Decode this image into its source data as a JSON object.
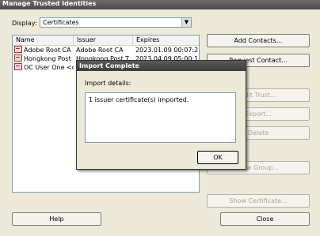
{
  "window": {
    "title": "Manage Trusted Identities"
  },
  "display": {
    "label": "Display:",
    "value": "Certificates"
  },
  "list": {
    "columns": [
      "Name",
      "Issuer",
      "Expires"
    ],
    "rows": [
      {
        "name": "Adobe Root CA",
        "issuer": "Adobe Root CA",
        "expires": "2023.01.09 00:07:2..."
      },
      {
        "name": "Hongkong Post ...",
        "issuer": "Hongkong Post T...",
        "expires": "2023.04.09 05:00:1..."
      },
      {
        "name": "OC User One <o...",
        "issuer": "",
        "expires": ""
      }
    ]
  },
  "buttons": {
    "add_contacts": "Add Contacts...",
    "request_contact": "Request Contact...",
    "edit_trust": "Edit Trust...",
    "export": "Export...",
    "delete": "Delete",
    "new_group": "New Group...",
    "show_certificate": "Show Certificate...",
    "help": "Help",
    "close": "Close"
  },
  "dialog": {
    "title": "Import Complete",
    "details_label": "Import details:",
    "message": "1 issuer certificate(s) imported.",
    "ok": "OK"
  }
}
